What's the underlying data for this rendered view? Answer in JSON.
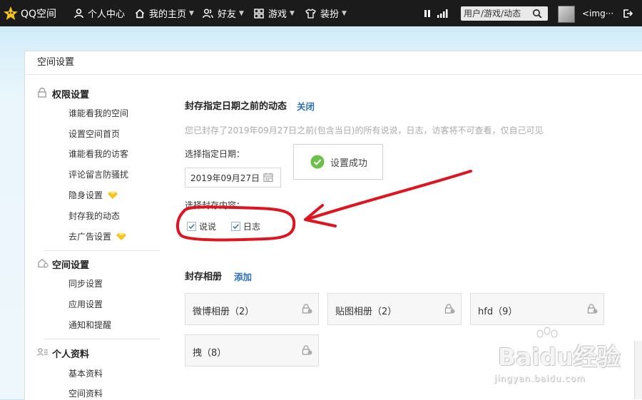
{
  "topbar": {
    "logo": "QQ空间",
    "nav": [
      {
        "label": "个人中心",
        "icon": "person-icon"
      },
      {
        "label": "我的主页",
        "icon": "home-icon",
        "dropdown": true
      },
      {
        "label": "好友",
        "icon": "friends-icon",
        "dropdown": true
      },
      {
        "label": "游戏",
        "icon": "grid-icon",
        "dropdown": true
      },
      {
        "label": "装扮",
        "icon": "shirt-icon",
        "dropdown": true
      }
    ],
    "search_placeholder": "用户/游戏/动态",
    "username": "<img···"
  },
  "panel": {
    "title": "空间设置"
  },
  "sidebar": {
    "groups": [
      {
        "title": "权限设置",
        "icon": "lock-icon",
        "items": [
          {
            "label": "谁能看我的空间"
          },
          {
            "label": "设置空间首页"
          },
          {
            "label": "谁能看我的访客"
          },
          {
            "label": "评论留言防骚扰"
          },
          {
            "label": "隐身设置",
            "vip": true
          },
          {
            "label": "封存我的动态"
          },
          {
            "label": "去广告设置",
            "vip": true
          }
        ]
      },
      {
        "title": "空间设置",
        "icon": "house-settings-icon",
        "items": [
          {
            "label": "同步设置"
          },
          {
            "label": "应用设置"
          },
          {
            "label": "通知和提醒"
          }
        ]
      },
      {
        "title": "个人资料",
        "icon": "profile-card-icon",
        "items": [
          {
            "label": "基本资料"
          },
          {
            "label": "空间资料"
          }
        ]
      }
    ]
  },
  "archive": {
    "title": "封存指定日期之前的动态",
    "close_link": "关闭",
    "description": "您已封存了2019年09月27日之前(包含当日)的所有说说，日志，访客将不可查看，仅自己可见",
    "date_label": "选择指定日期：",
    "date_value": "2019年09月27日",
    "content_label": "选择封存内容：",
    "options": [
      {
        "label": "说说",
        "checked": true
      },
      {
        "label": "日志",
        "checked": true
      }
    ],
    "toast": "设置成功"
  },
  "albums": {
    "title": "封存相册",
    "add_link": "添加",
    "items": [
      {
        "name": "微博相册（2）"
      },
      {
        "name": "贴图相册（2）"
      },
      {
        "name": "hfd（9）"
      },
      {
        "name": "拽（8）"
      }
    ]
  },
  "watermark": {
    "brand": "Baidu经验",
    "url": "jingyan.baidu.com"
  },
  "colors": {
    "topbar": "#1b1b1b",
    "link": "#2a6fb7",
    "vip": "#f5c518",
    "success": "#6cc04a",
    "annotation": "#e0141e"
  }
}
